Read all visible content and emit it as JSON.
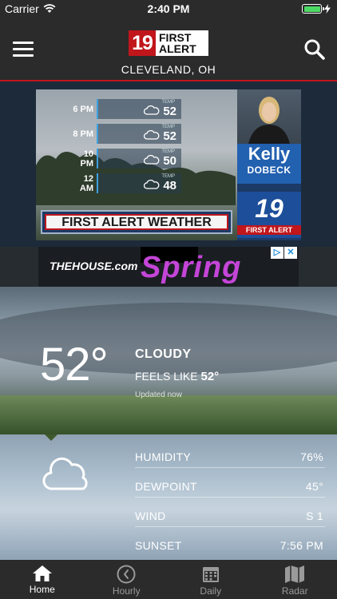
{
  "status_bar": {
    "carrier": "Carrier",
    "time": "2:40 PM"
  },
  "header": {
    "logo_number": "19",
    "logo_line1": "FIRST",
    "logo_line2": "ALERT",
    "location": "CLEVELAND, OH"
  },
  "video": {
    "forecast": [
      {
        "time": "6 PM",
        "label": "TEMP",
        "temp": "52"
      },
      {
        "time": "8 PM",
        "label": "TEMP",
        "temp": "52"
      },
      {
        "time": "10 PM",
        "label": "TEMP",
        "temp": "50"
      },
      {
        "time": "12 AM",
        "label": "TEMP",
        "temp": "48"
      }
    ],
    "presenter_first": "Kelly",
    "presenter_last": "DOBECK",
    "logo_number": "19",
    "logo_text": "FIRST ALERT",
    "banner": "FIRST ALERT WEATHER"
  },
  "ad": {
    "house_text": "THEHOUSE.com",
    "spring_text": "Spring",
    "info_icon": "▷",
    "close_icon": "✕"
  },
  "current": {
    "temp": "52°",
    "condition": "CLOUDY",
    "feels_label": "FEELS LIKE",
    "feels_value": "52°",
    "updated": "Updated now"
  },
  "details": [
    {
      "label": "HUMIDITY",
      "value": "76%"
    },
    {
      "label": "DEWPOINT",
      "value": "45°"
    },
    {
      "label": "WIND",
      "value": "S 1"
    },
    {
      "label": "SUNSET",
      "value": "7:56 PM"
    }
  ],
  "tabs": [
    {
      "label": "Home",
      "icon": "home-icon",
      "active": true
    },
    {
      "label": "Hourly",
      "icon": "clock-icon",
      "active": false
    },
    {
      "label": "Daily",
      "icon": "calendar-icon",
      "active": false
    },
    {
      "label": "Radar",
      "icon": "map-icon",
      "active": false
    }
  ],
  "colors": {
    "brand_red": "#c0161c",
    "header_bg": "#2b2b2b",
    "active_tab": "#ffffff",
    "inactive_tab": "#9a9a9a"
  }
}
